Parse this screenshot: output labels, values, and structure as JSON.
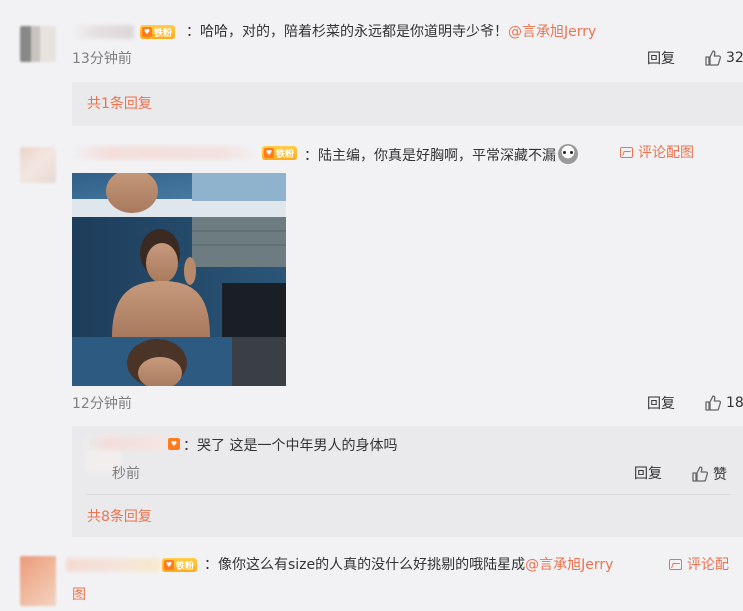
{
  "comment1": {
    "badge": "铁粉",
    "text": "：哈哈，对的，陪着杉菜的永远都是你道明寺少爷！",
    "mention": "@言承旭Jerry",
    "time": "13分钟前",
    "reply_label": "回复",
    "like_count": "32",
    "replies_summary": "共1条回复"
  },
  "comment2": {
    "badge": "铁粉",
    "text": "：陆主编，你真是好胸啊，平常深藏不漏",
    "pic_link": "评论配图",
    "time": "12分钟前",
    "reply_label": "回复",
    "like_count": "18",
    "sub_reply": {
      "text": "：哭了 这是一个中年男人的身体吗",
      "time": "秒前",
      "reply_label": "回复",
      "like_label": "赞"
    },
    "replies_summary": "共8条回复"
  },
  "comment3": {
    "badge": "铁粉",
    "text": "：像你这么有size的人真的没什么好挑剔的哦陆星成",
    "mention": "@言承旭Jerry",
    "pic_link_part1": "评论配",
    "pic_link_part2": "图"
  },
  "colors": {
    "link": "#eb7350",
    "background": "#f2f2f5",
    "panel": "#eaeaec"
  }
}
